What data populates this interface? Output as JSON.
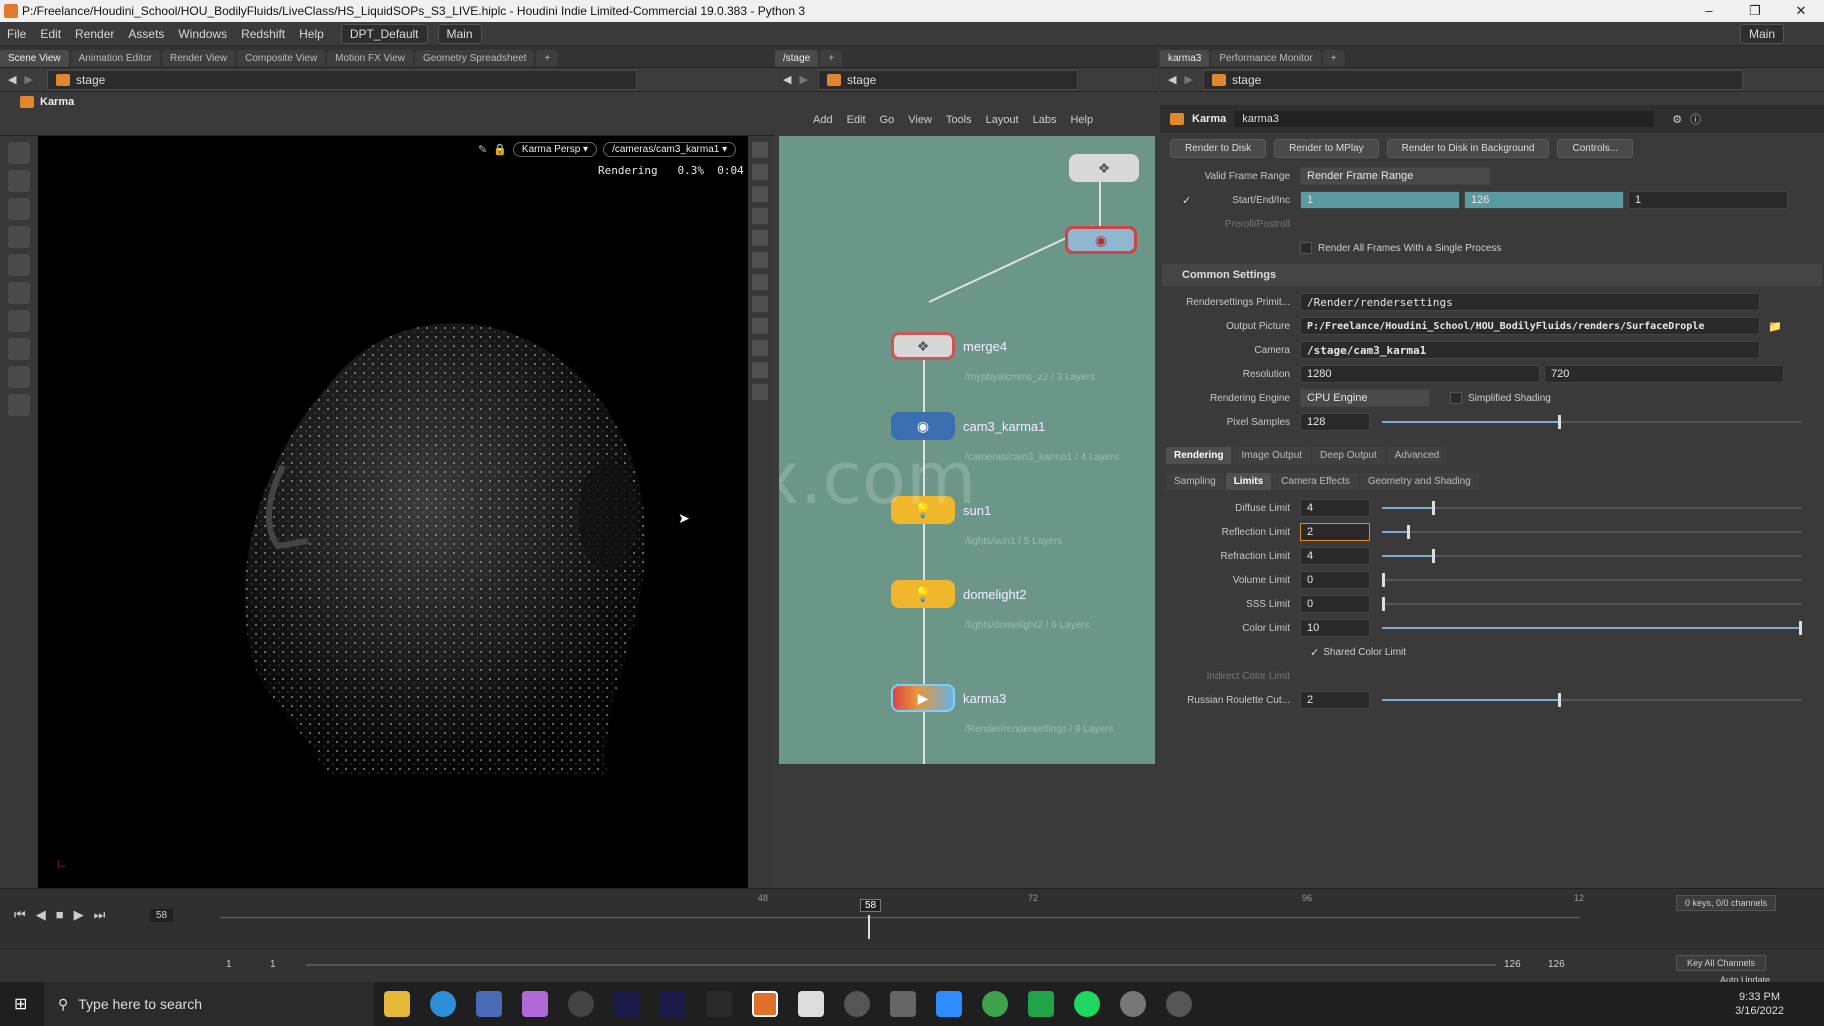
{
  "window": {
    "title": "P:/Freelance/Houdini_School/HOU_BodilyFluids/LiveClass/HS_LiquidSOPs_S3_LIVE.hiplc - Houdini Indie Limited-Commercial 19.0.383 - Python 3",
    "controls": [
      "–",
      "❐",
      "✕"
    ]
  },
  "menu": [
    "File",
    "Edit",
    "Render",
    "Assets",
    "Windows",
    "Redshift",
    "Help"
  ],
  "desktops": [
    "DPT_Default",
    "Main"
  ],
  "desktop_right": "Main",
  "left_tabs": [
    "Scene View",
    "Animation Editor",
    "Render View",
    "Composite View",
    "Motion FX View",
    "Geometry Spreadsheet"
  ],
  "mid_tabs": [
    "/stage"
  ],
  "right_tabs": [
    "karma3",
    "Performance Monitor"
  ],
  "path": "stage",
  "viewport": {
    "renderer": "Karma",
    "camera_menu": "Karma Persp ▾",
    "cam_path": "/cameras/cam3_karma1 ▾",
    "status": "Rendering   0.3%  0:04"
  },
  "network": {
    "menu": [
      "Add",
      "Edit",
      "Go",
      "View",
      "Tools",
      "Layout",
      "Labs",
      "Help"
    ],
    "watermark": "iiivfx.com",
    "nodes": [
      {
        "name": "merge4",
        "sub": "/mypbyatcmms_z2 / 3 Layers"
      },
      {
        "name": "cam3_karma1",
        "sub": "/cameras/cam3_karma1 / 4 Layers"
      },
      {
        "name": "sun1",
        "sub": "/lights/sun1 / 5 Layers"
      },
      {
        "name": "domelight2",
        "sub": "/lights/domelight2 / 6 Layers"
      },
      {
        "name": "karma3",
        "sub": "/Render/rendersettings / 8 Layers"
      }
    ]
  },
  "params": {
    "type": "Karma",
    "node": "karma3",
    "buttons": [
      "Render to Disk",
      "Render to MPlay",
      "Render to Disk in Background",
      "Controls..."
    ],
    "valid_frame_range_label": "Valid Frame Range",
    "valid_frame_range": "Render Frame Range",
    "start_end_label": "Start/End/Inc",
    "start": "1",
    "end": "126",
    "inc": "1",
    "preroll_label": "Preroll/Postroll",
    "single_process": "Render All Frames With a Single Process",
    "common_section": "Common Settings",
    "rendersettings_label": "Rendersettings Primit...",
    "rendersettings": "/Render/rendersettings",
    "output_label": "Output Picture",
    "output": "P:/Freelance/Houdini_School/HOU_BodilyFluids/renders/SurfaceDrople",
    "camera_label": "Camera",
    "camera": "/stage/cam3_karma1",
    "resolution_label": "Resolution",
    "res_x": "1280",
    "res_y": "720",
    "engine_label": "Rendering Engine",
    "engine": "CPU Engine",
    "simplified_shading": "Simplified Shading",
    "pixel_samples_label": "Pixel Samples",
    "pixel_samples": "128",
    "main_tabs": [
      "Rendering",
      "Image Output",
      "Deep Output",
      "Advanced"
    ],
    "sub_tabs": [
      "Sampling",
      "Limits",
      "Camera Effects",
      "Geometry and Shading"
    ],
    "limits": [
      {
        "label": "Diffuse Limit",
        "value": "4",
        "frac": 0.12
      },
      {
        "label": "Reflection Limit",
        "value": "2",
        "frac": 0.06
      },
      {
        "label": "Refraction Limit",
        "value": "4",
        "frac": 0.12
      },
      {
        "label": "Volume Limit",
        "value": "0",
        "frac": 0.0
      },
      {
        "label": "SSS Limit",
        "value": "0",
        "frac": 0.0
      },
      {
        "label": "Color Limit",
        "value": "10",
        "frac": 1.0
      }
    ],
    "shared_color_limit": "Shared Color Limit",
    "indirect_color_limit_label": "Indirect Color Limit",
    "russian_label": "Russian Roulette Cut...",
    "russian": "2"
  },
  "timeline": {
    "current_frame": "58",
    "frame_field": "58",
    "ticks": [
      "48",
      "72",
      "96",
      "12"
    ],
    "start": "1",
    "start2": "1",
    "end": "126",
    "end2": "126",
    "keys": "0 keys, 0/0 channels",
    "key_all": "Key All Channels",
    "auto_update": "Auto Update"
  },
  "taskbar": {
    "search_placeholder": "Type here to search",
    "time": "9:33 PM",
    "date": "3/16/2022"
  }
}
